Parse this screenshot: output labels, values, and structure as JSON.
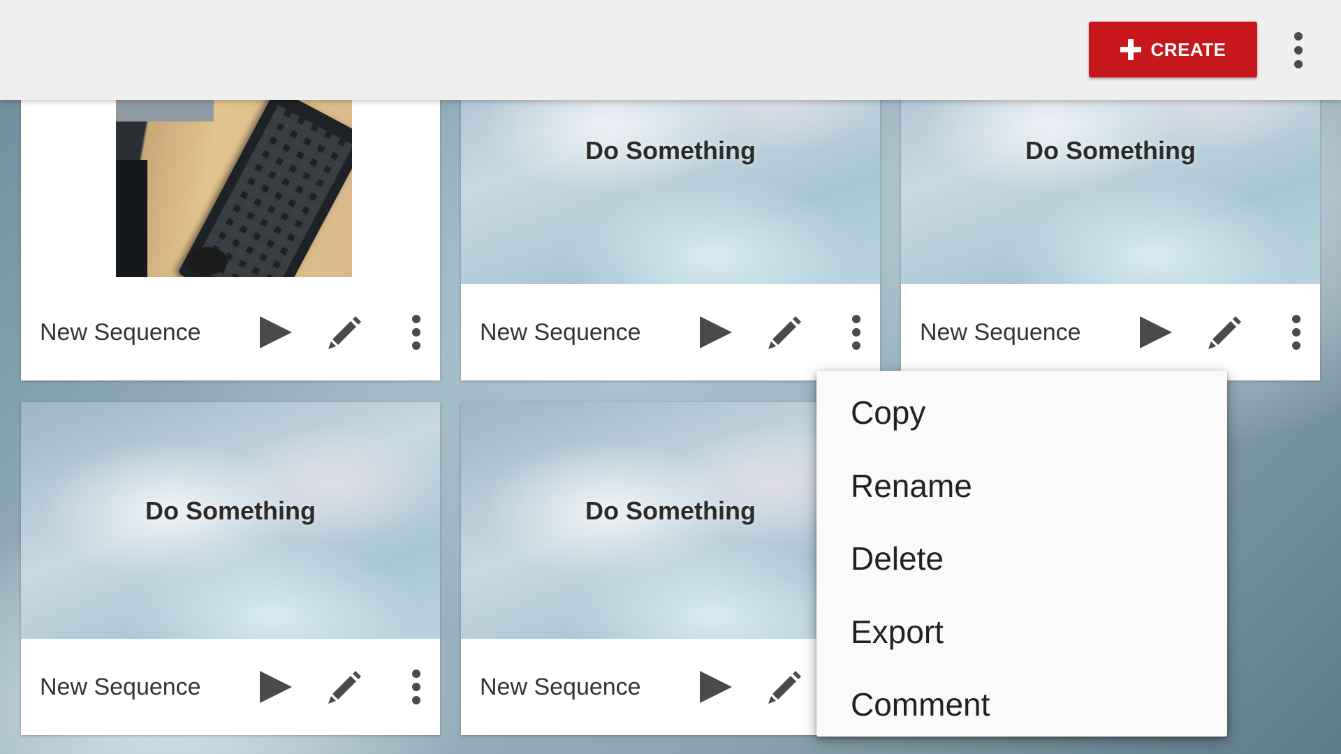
{
  "topbar": {
    "create_label": "CREATE",
    "create_icon": "plus-icon",
    "overflow_icon": "more-vert-icon"
  },
  "cards": [
    {
      "thumbnail_type": "photo",
      "thumbnail_title": "",
      "name": "New Sequence"
    },
    {
      "thumbnail_type": "title",
      "thumbnail_title": "Do Something",
      "name": "New Sequence"
    },
    {
      "thumbnail_type": "title",
      "thumbnail_title": "Do Something",
      "name": "New Sequence"
    },
    {
      "thumbnail_type": "title",
      "thumbnail_title": "Do Something",
      "name": "New Sequence"
    },
    {
      "thumbnail_type": "title",
      "thumbnail_title": "Do Something",
      "name": "New Sequence"
    }
  ],
  "card_actions": [
    "play-icon",
    "edit-icon",
    "more-vert-icon"
  ],
  "menu": {
    "items": [
      "Copy",
      "Rename",
      "Delete",
      "Export",
      "Comment"
    ]
  },
  "colors": {
    "accent": "#c8161d",
    "topbar": "#efefef",
    "icon": "#4a4a4a"
  }
}
